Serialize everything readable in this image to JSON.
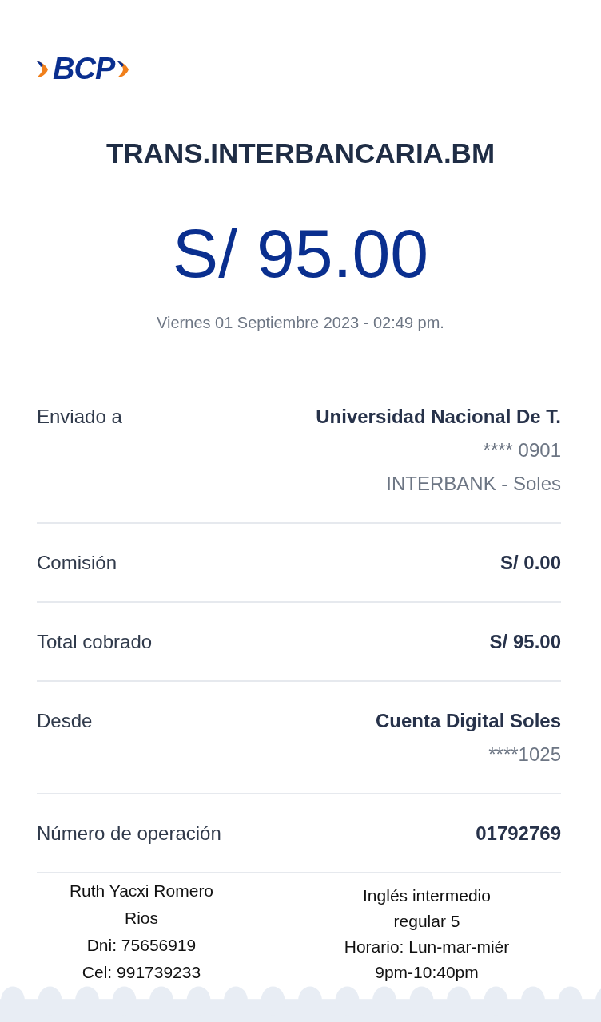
{
  "logo": {
    "text": "BCP"
  },
  "title": "TRANS.INTERBANCARIA.BM",
  "amount": "S/ 95.00",
  "date": "Viernes 01 Septiembre 2023 - 02:49 pm.",
  "details": [
    {
      "label": "Enviado a",
      "value": "Universidad Nacional De T.",
      "sub": [
        "**** 0901",
        "INTERBANK - Soles"
      ]
    },
    {
      "label": "Comisión",
      "value": "S/ 0.00"
    },
    {
      "label": "Total cobrado",
      "value": "S/ 95.00"
    },
    {
      "label": "Desde",
      "value": "Cuenta Digital Soles",
      "sub": [
        "****1025"
      ]
    },
    {
      "label": "Número de operación",
      "value": "01792769"
    }
  ],
  "notes": [
    [
      "Ruth Yacxi Romero",
      "Rios",
      "Dni: 75656919",
      "Cel: 991739233"
    ],
    [
      "Inglés intermedio",
      "regular 5",
      "Horario: Lun-mar-miér",
      "9pm-10:40pm"
    ]
  ]
}
